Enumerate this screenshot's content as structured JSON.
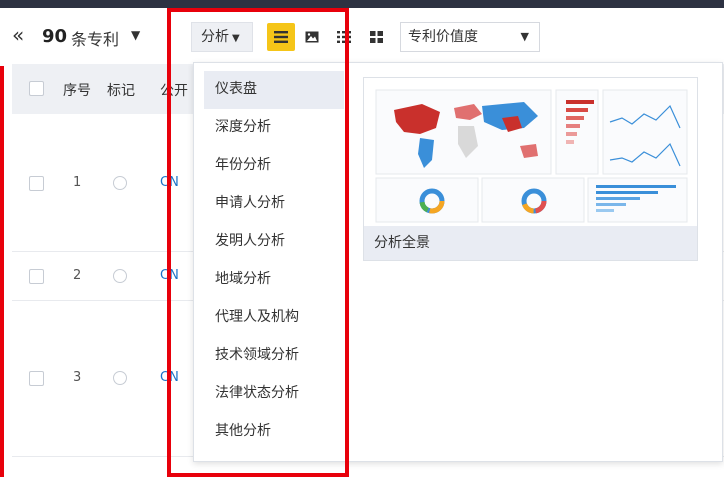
{
  "toolbar": {
    "collapse_glyph": "«",
    "count": "90",
    "count_label": "条专利",
    "analyze_label": "分析",
    "sort_value": "专利价值度",
    "icons": [
      "list-view-icon",
      "image-view-icon",
      "detail-view-icon",
      "grid-view-icon"
    ],
    "active_view_color": "#f5c518"
  },
  "table": {
    "headers": [
      "序号",
      "标记",
      "公开"
    ],
    "rows": [
      {
        "index": "1",
        "pub": "CN"
      },
      {
        "index": "2",
        "pub": "CN"
      },
      {
        "index": "3",
        "pub": "CN"
      }
    ]
  },
  "analysis_menu": {
    "items": [
      "仪表盘",
      "深度分析",
      "年份分析",
      "申请人分析",
      "发明人分析",
      "地域分析",
      "代理人及机构",
      "技术领域分析",
      "法律状态分析",
      "其他分析"
    ],
    "active_index": 0
  },
  "dashboard_card": {
    "label": "分析全景"
  },
  "highlight_color": "#e8000b"
}
